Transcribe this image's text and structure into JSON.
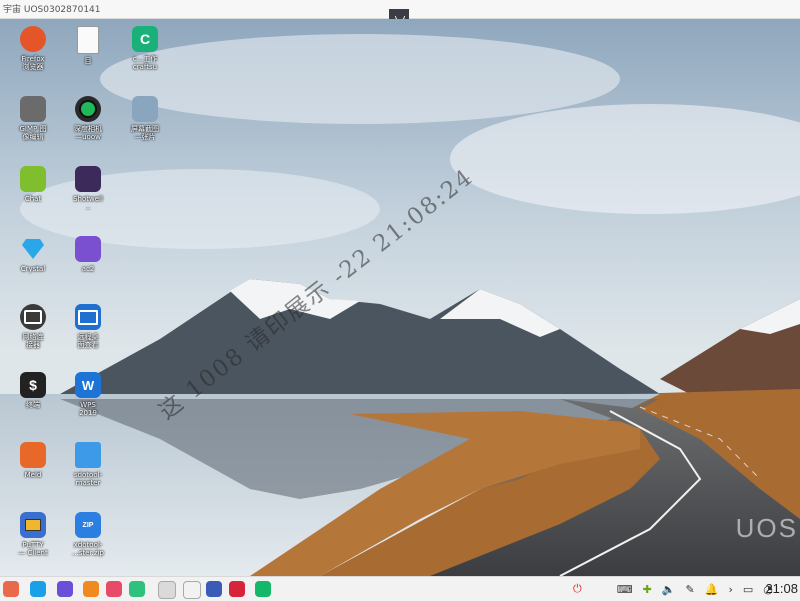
{
  "window": {
    "title": "宇宙    UOS0302870141"
  },
  "watermark": {
    "text": "这 1008    请印展示 -22  21:08:24"
  },
  "wallpaper_logo": "UOS",
  "desktop_icons": [
    {
      "name": "firefox-icon",
      "label": "Firefox\n浏览器",
      "color": "#e5552a",
      "glyph": "",
      "shape": "round"
    },
    {
      "name": "document-icon",
      "label": "目",
      "color": "#e8e8e8",
      "glyph": "",
      "shape": "doc"
    },
    {
      "name": "green-app-icon",
      "label": "c...工作\ncraftsu",
      "color": "#19b07a",
      "glyph": "C",
      "shape": "rounded"
    },
    {
      "name": "gimp-icon",
      "label": "GIMP 图\n像编辑",
      "color": "#6b6b6b",
      "glyph": "",
      "shape": "gimp"
    },
    {
      "name": "camera-icon",
      "label": "深度相机\n—uoow",
      "color": "#2a2a2a",
      "glyph": "",
      "shape": "camera"
    },
    {
      "name": "image-file-icon",
      "label": "屏幕截图\n—张片",
      "color": "#8aa6bf",
      "glyph": "",
      "shape": "photo"
    },
    {
      "name": "chat-icon",
      "label": "Chat",
      "color": "#7fbf2e",
      "glyph": "",
      "shape": "chat"
    },
    {
      "name": "wallpaper-icon",
      "label": "Shotwell\n..",
      "color": "#3b2a5a",
      "glyph": "",
      "shape": "night"
    },
    {
      "name": "diamond-icon",
      "label": "Crystal",
      "color": "#2aa7e8",
      "glyph": "",
      "shape": "diamond"
    },
    {
      "name": "purple-app-icon",
      "label": "ac2",
      "color": "#7a4fd0",
      "glyph": "",
      "shape": "puzzle"
    },
    {
      "name": "network-icon",
      "label": "网络连\n接器",
      "color": "#3a3a3a",
      "glyph": "",
      "shape": "network"
    },
    {
      "name": "monitor-icon",
      "label": "远程桌\n面查看",
      "color": "#1e6fd0",
      "glyph": "",
      "shape": "monitor"
    },
    {
      "name": "terminal-icon",
      "label": "终端",
      "color": "#222222",
      "glyph": "$",
      "shape": "term"
    },
    {
      "name": "wps-icon",
      "label": "WPS\n2019",
      "color": "#1e74d6",
      "glyph": "W",
      "shape": "wps"
    },
    {
      "name": "meld-icon",
      "label": "Meld",
      "color": "#e8682a",
      "glyph": "",
      "shape": "meld"
    },
    {
      "name": "folder-icon",
      "label": "sdotool-\nmaster",
      "color": "#3d9ae8",
      "glyph": "",
      "shape": "folder"
    },
    {
      "name": "putty-icon",
      "label": "PuTTY\n— Client",
      "color": "#3a6fd0",
      "glyph": "",
      "shape": "putty"
    },
    {
      "name": "zip-file-icon",
      "label": "xdotool-\n...ster.zip",
      "color": "#2b7fe0",
      "glyph": "ZIP",
      "shape": "zip"
    }
  ],
  "dock": {
    "apps": [
      {
        "name": "launcher-icon",
        "color": "#e86a4a"
      },
      {
        "name": "app-store-icon",
        "color": "#1aa0e8"
      },
      {
        "name": "moon-app-icon",
        "color": "#6b4fd8"
      },
      {
        "name": "orange-app-icon",
        "color": "#f08a1e"
      },
      {
        "name": "album-icon",
        "color": "#e84a6a"
      },
      {
        "name": "music-icon",
        "color": "#2ec27e"
      },
      {
        "name": "calendar-icon",
        "color": "#dadada"
      },
      {
        "name": "notes-icon",
        "color": "#f2f2f2"
      },
      {
        "name": "browser-icon",
        "color": "#3b5bb8"
      },
      {
        "name": "red-app-icon",
        "color": "#d8243a"
      },
      {
        "name": "green-app-dock-icon",
        "color": "#14b86a"
      }
    ],
    "tray": {
      "icons": [
        "shutdown-icon",
        "keyboard-icon",
        "input-method-icon",
        "volume-icon",
        "pen-icon",
        "bell-icon",
        "chevron-icon",
        "copy-icon",
        "wifi-icon"
      ],
      "clock": "21:08"
    }
  }
}
